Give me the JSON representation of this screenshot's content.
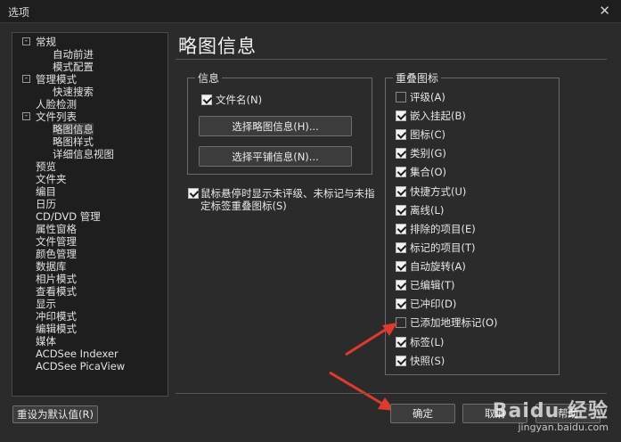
{
  "window": {
    "title": "选项",
    "close_glyph": "✕"
  },
  "tree": {
    "items": [
      {
        "label": "常规",
        "expander": "-"
      },
      {
        "label": "自动前进"
      },
      {
        "label": "模式配置"
      },
      {
        "label": "管理模式",
        "expander": "-"
      },
      {
        "label": "快速搜索"
      },
      {
        "label": "人脸检测"
      },
      {
        "label": "文件列表",
        "expander": "-"
      },
      {
        "label": "略图信息"
      },
      {
        "label": "略图样式"
      },
      {
        "label": "详细信息视图"
      },
      {
        "label": "预览"
      },
      {
        "label": "文件夹"
      },
      {
        "label": "编目"
      },
      {
        "label": "日历"
      },
      {
        "label": "CD/DVD 管理"
      },
      {
        "label": "属性窗格"
      },
      {
        "label": "文件管理"
      },
      {
        "label": "颜色管理"
      },
      {
        "label": "数据库"
      },
      {
        "label": "相片模式"
      },
      {
        "label": "查看模式"
      },
      {
        "label": "显示"
      },
      {
        "label": "冲印模式"
      },
      {
        "label": "编辑模式"
      },
      {
        "label": "媒体"
      },
      {
        "label": "ACDSee Indexer"
      },
      {
        "label": "ACDSee PicaView"
      }
    ]
  },
  "page": {
    "title": "略图信息"
  },
  "info_group": {
    "legend": "信息",
    "filename_checkbox": {
      "label": "文件名(N)",
      "checked": true
    },
    "select_thumb_info_button": "选择略图信息(H)...",
    "select_tile_info_button": "选择平铺信息(N)..."
  },
  "hover_option": {
    "label": "鼠标悬停时显示未评级、未标记与未指定标签重叠图标(S)",
    "checked": true
  },
  "overlay_group": {
    "legend": "重叠图标",
    "items": [
      {
        "label": "评级(A)",
        "checked": false
      },
      {
        "label": "嵌入挂起(B)",
        "checked": true
      },
      {
        "label": "图标(C)",
        "checked": true
      },
      {
        "label": "类别(G)",
        "checked": true
      },
      {
        "label": "集合(O)",
        "checked": true
      },
      {
        "label": "快捷方式(U)",
        "checked": true
      },
      {
        "label": "离线(L)",
        "checked": true
      },
      {
        "label": "排除的项目(E)",
        "checked": true
      },
      {
        "label": "标记的项目(T)",
        "checked": true
      },
      {
        "label": "自动旋转(A)",
        "checked": true
      },
      {
        "label": "已编辑(T)",
        "checked": true
      },
      {
        "label": "已冲印(D)",
        "checked": true
      },
      {
        "label": "已添加地理标记(O)",
        "checked": false
      },
      {
        "label": "标签(L)",
        "checked": true
      },
      {
        "label": "快照(S)",
        "checked": true
      }
    ]
  },
  "footer": {
    "reset_button": "重设为默认值(R)",
    "ok_button": "确定",
    "cancel_button": "取消",
    "help_button": "帮助"
  },
  "watermark": {
    "brand": "Baidu 经验",
    "url": "jingyan.baidu.com"
  },
  "colors": {
    "accent_arrow": "#e03a2f",
    "background": "#2b2b2b"
  }
}
